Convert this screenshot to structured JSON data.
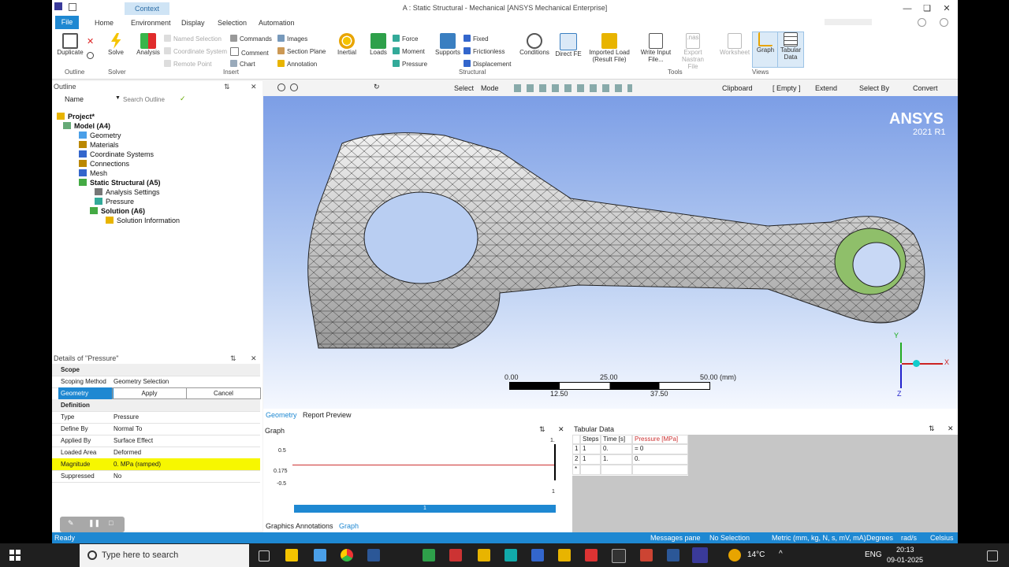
{
  "window": {
    "title": "A : Static Structural - Mechanical [ANSYS Mechanical Enterprise]",
    "context_tab": "Context"
  },
  "menu_tabs": [
    "Home",
    "Environment",
    "Display",
    "Selection",
    "Automation"
  ],
  "file_tab": "File",
  "ribbon": {
    "duplicate": "Duplicate",
    "solve": "Solve",
    "analysis": "Analysis",
    "named_selection": "Named Selection",
    "coordinate_system": "Coordinate System",
    "remote_point": "Remote Point",
    "commands": "Commands",
    "comment": "Comment",
    "chart": "Chart",
    "images": "Images",
    "section_plane": "Section Plane",
    "annotation": "Annotation",
    "inertial": "Inertial",
    "loads": "Loads",
    "force": "Force",
    "moment": "Moment",
    "pressure": "Pressure",
    "supports": "Supports",
    "fixed": "Fixed",
    "frictionless": "Frictionless",
    "displacement": "Displacement",
    "conditions": "Conditions",
    "direct_fe": "Direct FE",
    "imported_load": "Imported Load (Result File)",
    "write_input": "Write Input File...",
    "export_nastran": "Export Nastran File",
    "nas_label": ".nas",
    "worksheet": "Worksheet",
    "graph": "Graph",
    "tabular": "Tabular Data",
    "groups": [
      "Outline",
      "Solver",
      "Insert",
      "Structural",
      "Tools",
      "Views"
    ]
  },
  "outline": {
    "title": "Outline",
    "name_label": "Name",
    "search_placeholder": "Search Outline",
    "items": [
      {
        "label": "Project*",
        "bold": true
      },
      {
        "label": "Model (A4)",
        "bold": true
      },
      {
        "label": "Geometry",
        "bold": false
      },
      {
        "label": "Materials",
        "bold": false
      },
      {
        "label": "Coordinate Systems",
        "bold": false
      },
      {
        "label": "Connections",
        "bold": false
      },
      {
        "label": "Mesh",
        "bold": false
      },
      {
        "label": "Static Structural (A5)",
        "bold": true
      },
      {
        "label": "Analysis Settings",
        "bold": false
      },
      {
        "label": "Pressure",
        "bold": false
      },
      {
        "label": "Solution (A6)",
        "bold": true
      },
      {
        "label": "Solution Information",
        "bold": false
      }
    ]
  },
  "details": {
    "title": "Details of \"Pressure\"",
    "scope_header": "Scope",
    "scoping_method_k": "Scoping Method",
    "scoping_method_v": "Geometry Selection",
    "geometry_k": "Geometry",
    "apply": "Apply",
    "cancel": "Cancel",
    "definition_header": "Definition",
    "rows": [
      {
        "k": "Type",
        "v": "Pressure"
      },
      {
        "k": "Define By",
        "v": "Normal To"
      },
      {
        "k": "Applied By",
        "v": "Surface Effect"
      },
      {
        "k": "Loaded Area",
        "v": "Deformed"
      },
      {
        "k": "Magnitude",
        "v": "0. MPa  (ramped)"
      },
      {
        "k": "Suppressed",
        "v": "No"
      }
    ]
  },
  "viewport_toolbar": {
    "select": "Select",
    "mode": "Mode",
    "clipboard": "Clipboard",
    "empty": "[ Empty ]",
    "extend": "Extend",
    "select_by": "Select By",
    "convert": "Convert"
  },
  "viewport": {
    "brand": "ANSYS",
    "version": "2021 R1",
    "scale_top": [
      "0.00",
      "25.00",
      "50.00 (mm)"
    ],
    "scale_bottom": [
      "12.50",
      "37.50"
    ],
    "axis_x": "X",
    "axis_y": "Y",
    "axis_z": "Z"
  },
  "bottom_tabs": {
    "geometry": "Geometry",
    "report": "Report Preview"
  },
  "graph": {
    "title": "Graph",
    "y_ticks": [
      "0.5",
      "0.175",
      "-0.5"
    ],
    "top_right": "1.",
    "x_tick": "1",
    "slider_label": "1",
    "annotations_tab": "Graphics Annotations",
    "graph_tab": "Graph"
  },
  "tabular": {
    "title": "Tabular Data",
    "headers": [
      "Steps",
      "Time [s]",
      "Pressure [MPa]"
    ],
    "rows": [
      {
        "n": "1",
        "steps": "1",
        "time": "0.",
        "pressure": "= 0"
      },
      {
        "n": "2",
        "steps": "1",
        "time": "1.",
        "pressure": "0."
      },
      {
        "n": "*",
        "steps": "",
        "time": "",
        "pressure": ""
      }
    ]
  },
  "status": {
    "left": "Ready",
    "messages": "Messages pane",
    "selection": "No Selection",
    "units": "Metric (mm, kg, N, s, mV, mA)",
    "angle": "Degrees",
    "rate": "rad/s",
    "temp": "Celsius"
  },
  "taskbar": {
    "search": "Type here to search",
    "weather": "14°C",
    "lang": "ENG",
    "time": "20:13",
    "date": "09-01-2025"
  },
  "colors": {
    "accent": "#1e88d2",
    "highlight_yellow": "#f7f700",
    "viewport_top": "#7c9ee6"
  }
}
